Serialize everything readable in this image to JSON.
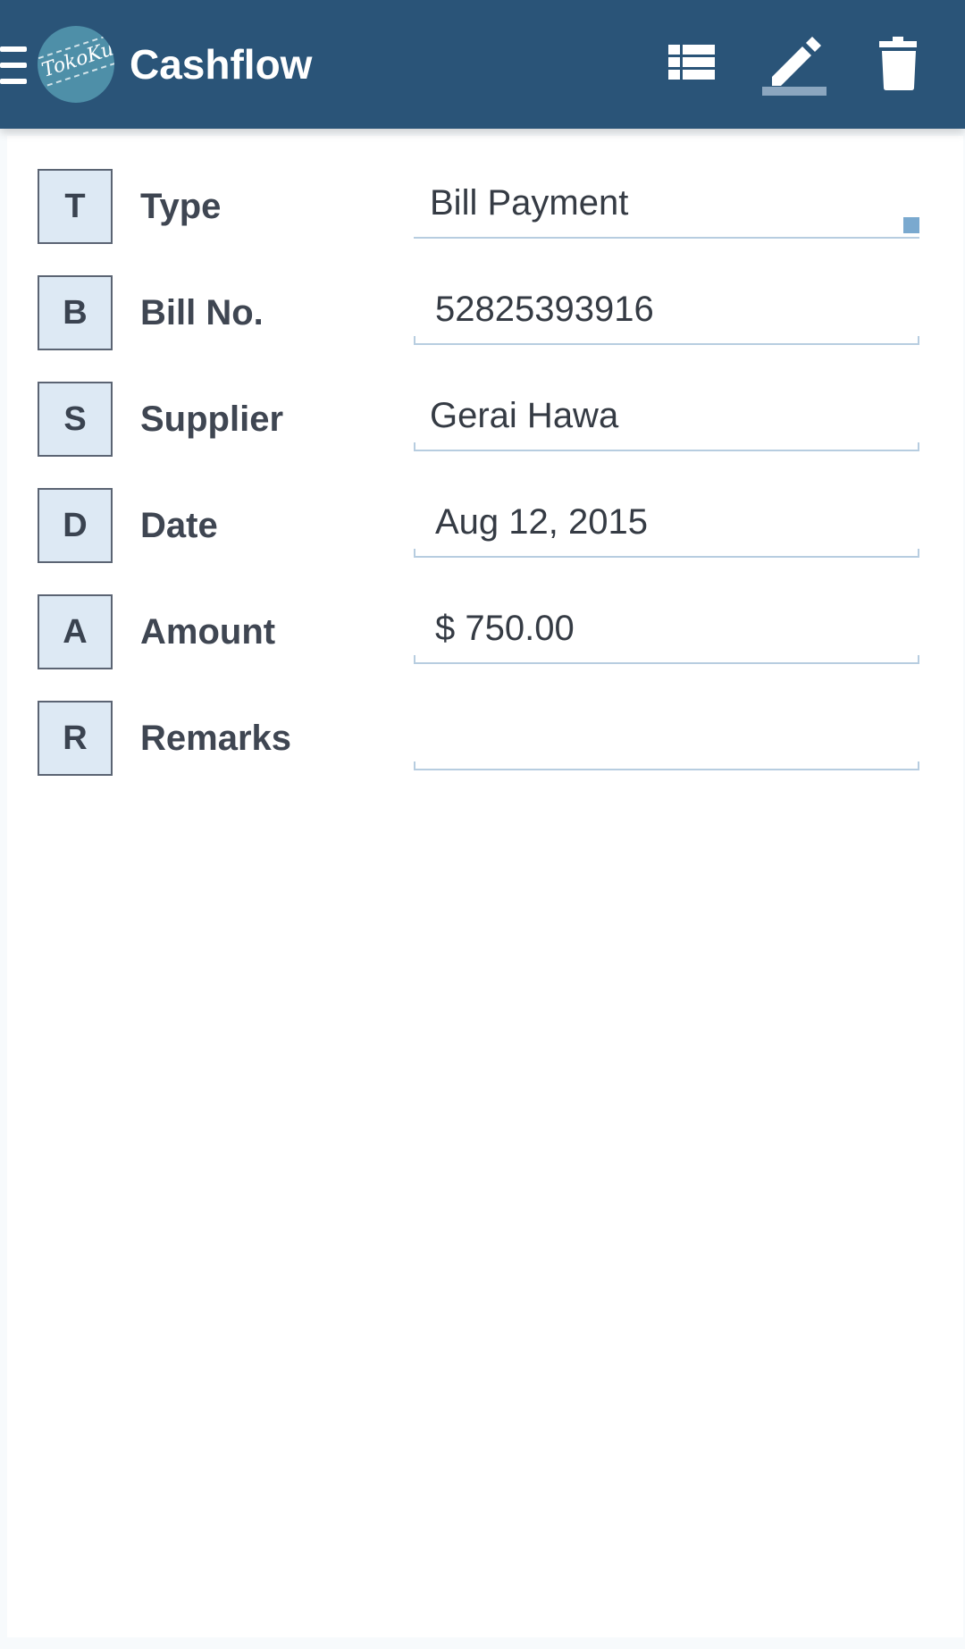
{
  "app": {
    "title": "Cashflow",
    "logo_text": "TokoKu"
  },
  "toolbar": {
    "icons": [
      "menu-icon",
      "list-icon",
      "edit-icon",
      "delete-icon"
    ],
    "active": "edit"
  },
  "colors": {
    "app_bar": "#2a5478",
    "badge_bg": "#dde9f4",
    "field_line": "#b7cde0",
    "accent": "#7aa9cf"
  },
  "form": {
    "rows": [
      {
        "badge": "T",
        "label": "Type",
        "value": "Bill Payment"
      },
      {
        "badge": "B",
        "label": "Bill No.",
        "value": "52825393916"
      },
      {
        "badge": "S",
        "label": "Supplier",
        "value": "Gerai Hawa"
      },
      {
        "badge": "D",
        "label": "Date",
        "value": "Aug 12, 2015"
      },
      {
        "badge": "A",
        "label": "Amount",
        "value": "$ 750.00"
      },
      {
        "badge": "R",
        "label": "Remarks",
        "value": ""
      }
    ]
  }
}
